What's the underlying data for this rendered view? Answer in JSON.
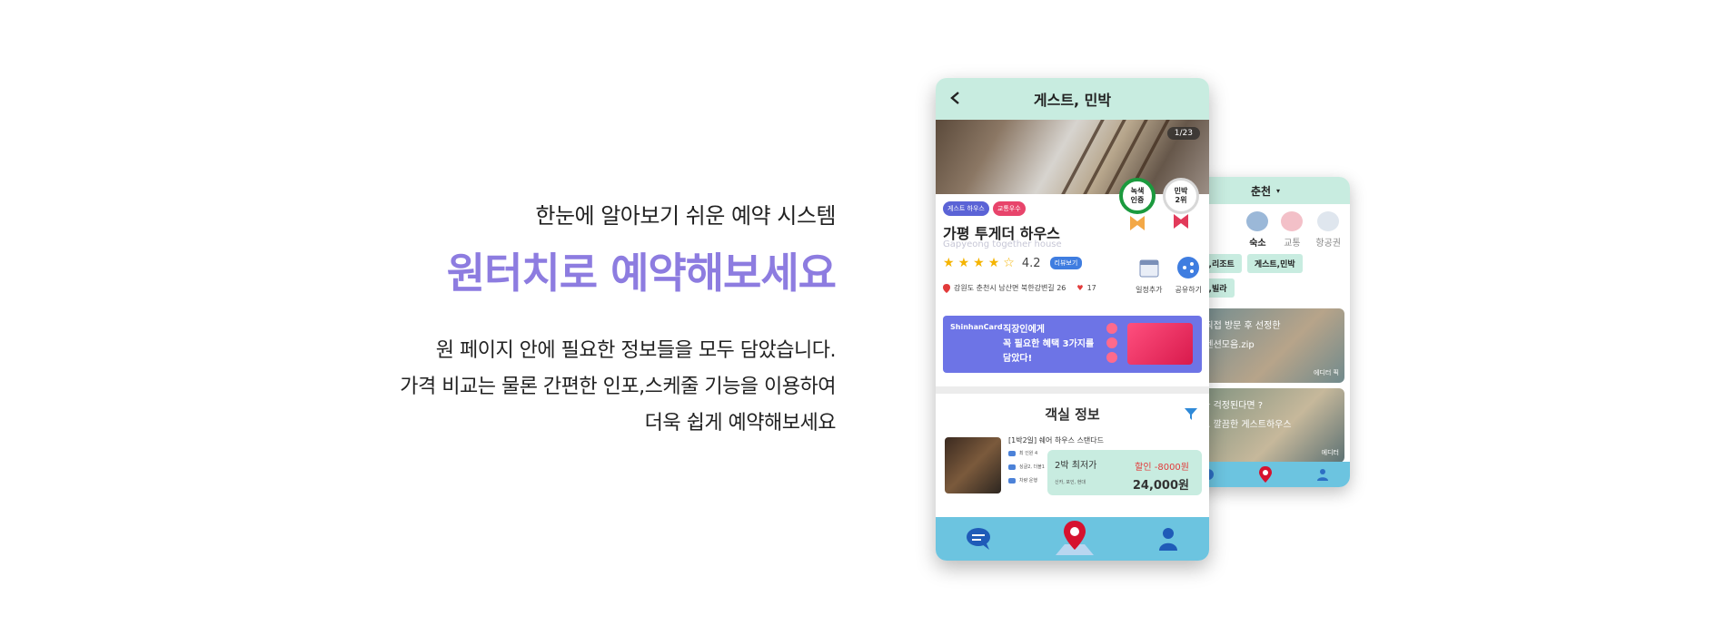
{
  "copy": {
    "subtitle": "한눈에 알아보기 쉬운 예약 시스템",
    "headline": "원터치로 예약해보세요",
    "desc_line1": "원 페이지 안에 필요한 정보들을 모두 담았습니다.",
    "desc_line2": "가격 비교는 물론 간편한 인포,스케줄 기능을 이용하여",
    "desc_line3": "더욱 쉽게 예약해보세요"
  },
  "back_phone": {
    "location": "춘천",
    "categories": [
      {
        "label": "숙소",
        "icon": "building-icon"
      },
      {
        "label": "교통",
        "icon": "car-icon"
      },
      {
        "label": "항공권",
        "icon": "plane-icon"
      }
    ],
    "tags": [
      "호텔,리조트",
      "게스트,민박",
      "펜션,빌라"
    ],
    "card1": {
      "line1": "가 직접 방문 후 선정한",
      "line2": "변 펜션모음.zip",
      "source": "에디터 픽"
    },
    "card2": {
      "line1": "네가 걱정된다면 ?",
      "line2": "하고 깔끔한 게스트하우스",
      "source": "에디터"
    }
  },
  "phone": {
    "title": "게스트, 민박",
    "image_counter": "1/23",
    "badge1": "녹색\n인증",
    "badge2": "민박\n2위",
    "chip1": "게스트 하우스",
    "chip2": "교통우수",
    "name": "가평 투게더 하우스",
    "name_en": "Gapyeong together house",
    "rating": "4.2",
    "review_chip": "리뷰보기",
    "address": "강원도 춘천시 남산면 북한강변길 26",
    "likes": "17",
    "action1": "일정추가",
    "action2": "공유하기",
    "ad": {
      "brand": "ShinhanCard",
      "line1": "직장인에게",
      "line2": "꼭 필요한 혜택 3가지를",
      "line3": "담았다!"
    },
    "room_section_title": "객실 정보",
    "room": {
      "name": "[1박2일] 쉐어 하우스 스탠다드",
      "feat1": "최 인원 4",
      "feat2": "싱글2, 더블1",
      "feat3": "차량 운행",
      "price_label": "2박 최저가",
      "discount": "할인 -8000원",
      "price": "24,000원",
      "payment": "신카, 포인, 현대"
    }
  }
}
